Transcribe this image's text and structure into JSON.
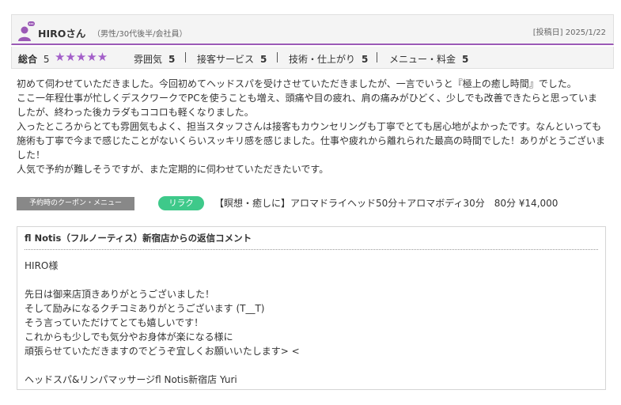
{
  "reviewer": {
    "name": "HIROさん",
    "info": "（男性/30代後半/会社員）",
    "post_date": "[投稿日] 2025/1/22"
  },
  "ratings": {
    "overall_label": "総合",
    "overall_value": "5",
    "stars": "★★★★★",
    "star_count": 5,
    "items": [
      {
        "label": "雰囲気",
        "value": "5"
      },
      {
        "label": "接客サービス",
        "value": "5"
      },
      {
        "label": "技術・仕上がり",
        "value": "5"
      },
      {
        "label": "メニュー・料金",
        "value": "5"
      }
    ]
  },
  "review_lines": [
    "初めて伺わせていただきました。今回初めてヘッドスパを受けさせていただきましたが、一言でいうと『極上の癒し時間』でした。",
    "ここ一年程仕事が忙しくデスクワークでPCを使うことも増え、頭痛や目の疲れ、肩の痛みがひどく、少しでも改善できたらと思っていま",
    "したが、終わった後カラダもココロも軽くなりました。",
    "入ったところからとても雰囲気もよく、担当スタッフさんは接客もカウンセリングも丁寧でとても居心地がよかったです。なんといっても",
    "施術も丁寧で今まで感じたことがないくらいスッキリ感を感じました。仕事や疲れから離れられた最高の時間でした！ありがとうございま",
    "した！",
    "人気で予約が難しそうですが、また定期的に伺わせていただきたいです。"
  ],
  "coupon": {
    "tag_label": "予約時のクーポン・メニュー",
    "badge": "リラク",
    "menu_text": "【瞑想・癒しに】アロマドライヘッド50分＋アロマボディ30分　80分 ¥14,000"
  },
  "reply": {
    "title": "fl Notis（フルノーティス）新宿店からの返信コメント",
    "lines": [
      "HIRO様",
      "",
      "先日は御来店頂きありがとうございました！",
      "そして励みになるクチコミありがとうございます (T__T)",
      "そう言っていただけてとても嬉しいです！",
      "これからも少しでも気分やお身体が楽になる様に",
      "頑張らせていただきますのでどうぞ宜しくお願いいたします> <",
      "",
      "ヘッドスパ&リンパマッサージfl Notis新宿店 Yuri"
    ]
  },
  "colors": {
    "accent_purple": "#9b59b6",
    "star_purple": "#a35fc9",
    "badge_green": "#3ec98a",
    "tag_gray": "#888888"
  }
}
